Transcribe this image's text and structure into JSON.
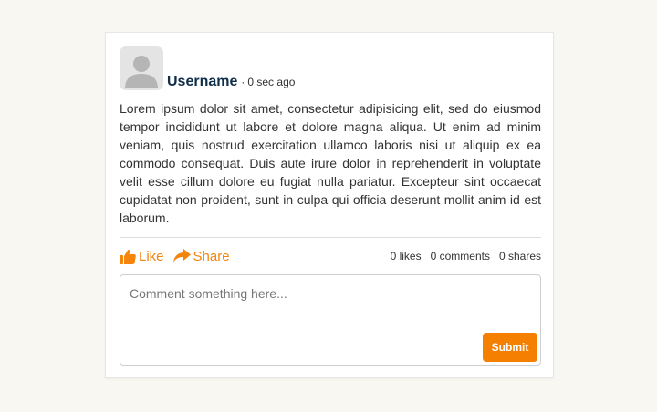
{
  "post": {
    "username": "Username",
    "separator": "·",
    "time": "0 sec ago",
    "body": "Lorem ipsum dolor sit amet, consectetur adipisicing elit, sed do eiusmod tempor incididunt ut labore et dolore magna aliqua. Ut enim ad minim veniam, quis nostrud exercitation ullamco laboris nisi ut aliquip ex ea commodo consequat. Duis aute irure dolor in reprehenderit in voluptate velit esse cillum dolore eu fugiat nulla pariatur. Excepteur sint occaecat cupidatat non proident, sunt in culpa qui officia deserunt mollit anim id est laborum."
  },
  "actions": {
    "like_label": "Like",
    "like_icon": "thumbs-up-icon",
    "share_label": "Share",
    "share_icon": "share-arrow-icon"
  },
  "stats": {
    "likes": "0 likes",
    "comments": "0 comments",
    "shares": "0 shares"
  },
  "comment": {
    "placeholder": "Comment something here...",
    "value": "",
    "submit_label": "Submit"
  },
  "colors": {
    "accent": "#f5840c",
    "username": "#0f2e4a",
    "background": "#f8f7f1"
  }
}
